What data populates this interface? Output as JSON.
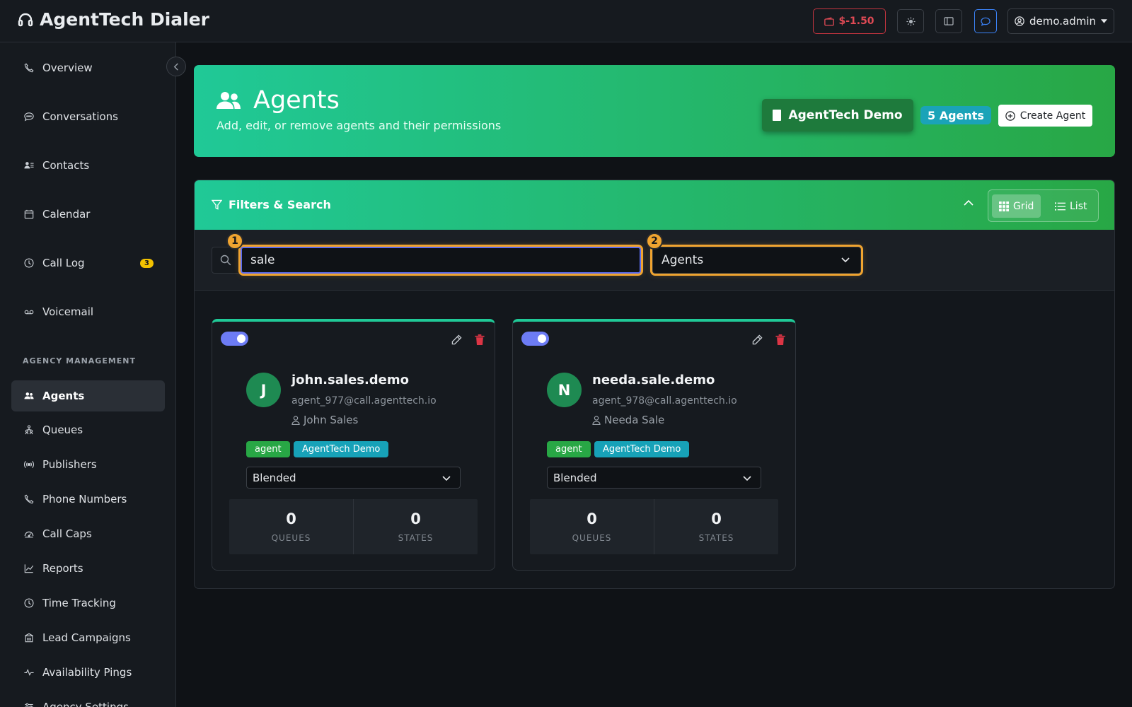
{
  "app": {
    "title": "AgentTech Dialer"
  },
  "topbar": {
    "balance": "$-1.50",
    "user": "demo.admin",
    "icons": [
      "wallet-icon",
      "sun-icon",
      "sidebar-toggle-icon",
      "chat-icon",
      "user-circle-icon",
      "caret-down-icon"
    ]
  },
  "sidebar": {
    "items": [
      {
        "label": "Overview",
        "icon": "phone-icon"
      },
      {
        "label": "Conversations",
        "icon": "chat-icon"
      },
      {
        "label": "Contacts",
        "icon": "contacts-icon"
      },
      {
        "label": "Calendar",
        "icon": "calendar-icon"
      },
      {
        "label": "Call Log",
        "icon": "clock-icon",
        "badge": "3"
      },
      {
        "label": "Voicemail",
        "icon": "voicemail-icon"
      }
    ],
    "section_label": "AGENCY MANAGEMENT",
    "agency_items": [
      {
        "label": "Agents",
        "icon": "users-icon",
        "active": true
      },
      {
        "label": "Queues",
        "icon": "queue-icon"
      },
      {
        "label": "Publishers",
        "icon": "broadcast-icon"
      },
      {
        "label": "Phone Numbers",
        "icon": "phone-icon"
      },
      {
        "label": "Call Caps",
        "icon": "gauge-icon"
      },
      {
        "label": "Reports",
        "icon": "chart-icon"
      },
      {
        "label": "Time Tracking",
        "icon": "clock-icon"
      },
      {
        "label": "Lead Campaigns",
        "icon": "building-icon"
      },
      {
        "label": "Availability Pings",
        "icon": "pulse-icon"
      },
      {
        "label": "Agency Settings",
        "icon": "settings-icon"
      }
    ]
  },
  "header": {
    "title": "Agents",
    "subtitle": "Add, edit, or remove agents and their permissions",
    "org_button": "AgentTech Demo",
    "count_badge": "5 Agents",
    "create_button": "Create Agent"
  },
  "filters": {
    "title": "Filters & Search",
    "view_grid": "Grid",
    "view_list": "List",
    "search_value": "sale",
    "role_value": "Agents",
    "markers": [
      "1",
      "2"
    ]
  },
  "agents": [
    {
      "initial": "J",
      "username": "john.sales.demo",
      "email": "agent_977@call.agenttech.io",
      "full_name": "John Sales",
      "role_tag": "agent",
      "org_tag": "AgentTech Demo",
      "mode": "Blended",
      "queues": "0",
      "queues_label": "QUEUES",
      "states": "0",
      "states_label": "STATES",
      "enabled": true
    },
    {
      "initial": "N",
      "username": "needa.sale.demo",
      "email": "agent_978@call.agenttech.io",
      "full_name": "Needa Sale",
      "role_tag": "agent",
      "org_tag": "AgentTech Demo",
      "mode": "Blended",
      "queues": "0",
      "queues_label": "QUEUES",
      "states": "0",
      "states_label": "STATES",
      "enabled": true
    }
  ],
  "colors": {
    "accent_from": "#20c997",
    "accent_to": "#28a745",
    "danger": "#dc3545",
    "highlight": "#f0a430",
    "toggle_on": "#6d7cf5"
  }
}
